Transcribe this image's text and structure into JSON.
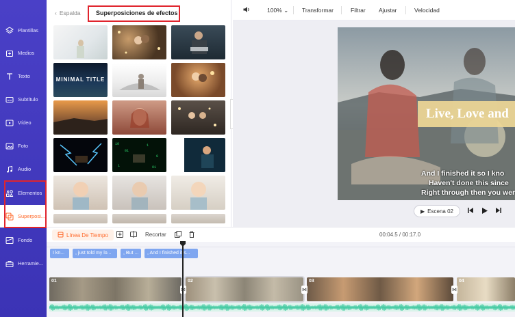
{
  "sidebar": {
    "items": [
      {
        "label": "Plantillas",
        "icon": "layers-icon"
      },
      {
        "label": "Medios",
        "icon": "media-folder-icon"
      },
      {
        "label": "Texto",
        "icon": "text-icon"
      },
      {
        "label": "Subtítulo",
        "icon": "subtitle-icon"
      },
      {
        "label": "Vídeo",
        "icon": "video-icon"
      },
      {
        "label": "Foto",
        "icon": "image-icon"
      },
      {
        "label": "Audio",
        "icon": "music-note-icon"
      },
      {
        "label": "Elementos",
        "icon": "elements-icon"
      },
      {
        "label": "Superposi...",
        "icon": "overlay-icon",
        "active": true
      },
      {
        "label": "Fondo",
        "icon": "background-icon"
      },
      {
        "label": "Herramie...",
        "icon": "toolbox-icon"
      }
    ],
    "accent": "#ff6a2b",
    "background": "#4a40c7"
  },
  "panel": {
    "back_label": "Espalda",
    "title": "Superposiciones de efectos",
    "minimal_title_text": "MINIMAL TITLE"
  },
  "toolbar": {
    "zoom": "100%",
    "transform": "Transformar",
    "filter": "Filtrar",
    "adjust": "Ajustar",
    "speed": "Velocidad"
  },
  "preview": {
    "title_text": "Live, Love and",
    "subtitles": [
      "And I finished it so I kno",
      "Haven't done this since",
      "Right through then you wer"
    ],
    "scene_label": "Escena 02"
  },
  "timeline": {
    "tab_label": "Línea De Tiempo",
    "crop_label": "Recortar",
    "timecode": "00:04.5 / 00:17.0",
    "subtitle_chips": [
      "I kn...",
      ", just told my lo...",
      ", But ...",
      ", And I finished it s..."
    ],
    "clips": [
      "01",
      "02",
      "03",
      "04"
    ],
    "waveform_color": "#3fc9a0"
  }
}
